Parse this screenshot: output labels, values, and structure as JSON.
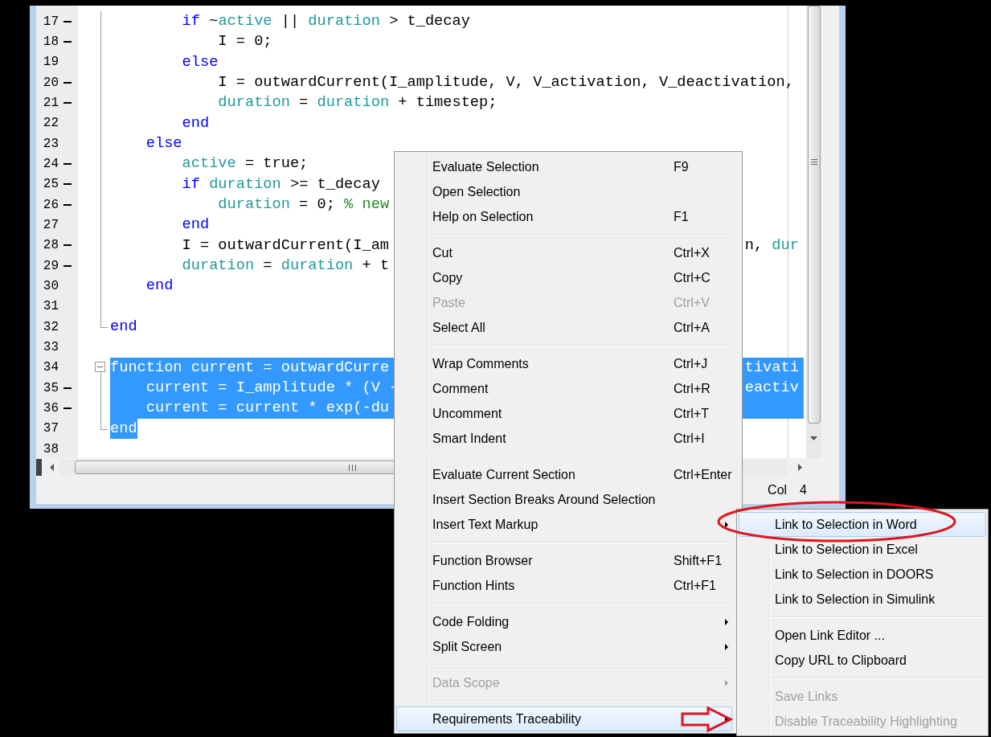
{
  "editor": {
    "lines": [
      {
        "number": "17",
        "marker": true,
        "fold_guide": true,
        "selected": false,
        "segments": [
          {
            "kind": "keyword",
            "text": "        if"
          },
          {
            "kind": "plain",
            "text": " ~"
          },
          {
            "kind": "variable",
            "text": "active"
          },
          {
            "kind": "plain",
            "text": " || "
          },
          {
            "kind": "variable",
            "text": "duration"
          },
          {
            "kind": "plain",
            "text": " > t_decay"
          }
        ]
      },
      {
        "number": "18",
        "marker": true,
        "fold_guide": true,
        "selected": false,
        "segments": [
          {
            "kind": "plain",
            "text": "            I = 0;"
          }
        ]
      },
      {
        "number": "19",
        "marker": false,
        "fold_guide": true,
        "selected": false,
        "segments": [
          {
            "kind": "keyword",
            "text": "        else"
          }
        ]
      },
      {
        "number": "20",
        "marker": true,
        "fold_guide": true,
        "selected": false,
        "segments": [
          {
            "kind": "plain",
            "text": "            I = outwardCurrent(I_amplitude, V, V_activation, V_deactivation,"
          }
        ]
      },
      {
        "number": "21",
        "marker": true,
        "fold_guide": true,
        "selected": false,
        "segments": [
          {
            "kind": "variable",
            "text": "            duration"
          },
          {
            "kind": "plain",
            "text": " = "
          },
          {
            "kind": "variable",
            "text": "duration"
          },
          {
            "kind": "plain",
            "text": " + timestep;"
          }
        ]
      },
      {
        "number": "22",
        "marker": false,
        "fold_guide": true,
        "selected": false,
        "segments": [
          {
            "kind": "keyword",
            "text": "        end"
          }
        ]
      },
      {
        "number": "23",
        "marker": false,
        "fold_guide": true,
        "selected": false,
        "segments": [
          {
            "kind": "keyword",
            "text": "    else"
          }
        ]
      },
      {
        "number": "24",
        "marker": true,
        "fold_guide": true,
        "selected": false,
        "segments": [
          {
            "kind": "variable",
            "text": "        active"
          },
          {
            "kind": "plain",
            "text": " = true;"
          }
        ]
      },
      {
        "number": "25",
        "marker": true,
        "fold_guide": true,
        "selected": false,
        "segments": [
          {
            "kind": "keyword",
            "text": "        if"
          },
          {
            "kind": "variable",
            "text": " duration"
          },
          {
            "kind": "plain",
            "text": " >= t_decay"
          }
        ]
      },
      {
        "number": "26",
        "marker": true,
        "fold_guide": true,
        "selected": false,
        "segments": [
          {
            "kind": "variable",
            "text": "            duration"
          },
          {
            "kind": "plain",
            "text": " = 0; "
          },
          {
            "kind": "comment",
            "text": "% new"
          }
        ]
      },
      {
        "number": "27",
        "marker": false,
        "fold_guide": true,
        "selected": false,
        "segments": [
          {
            "kind": "keyword",
            "text": "        end"
          }
        ]
      },
      {
        "number": "28",
        "marker": true,
        "fold_guide": true,
        "selected": false,
        "segments": [
          {
            "kind": "plain",
            "text": "        I = outwardCurrent(I_am"
          }
        ],
        "tail": [
          {
            "kind": "plain",
            "text": "n, "
          },
          {
            "kind": "variable",
            "text": "dur"
          }
        ]
      },
      {
        "number": "29",
        "marker": true,
        "fold_guide": true,
        "selected": false,
        "segments": [
          {
            "kind": "variable",
            "text": "        duration"
          },
          {
            "kind": "plain",
            "text": " = "
          },
          {
            "kind": "variable",
            "text": "duration"
          },
          {
            "kind": "plain",
            "text": " + t"
          }
        ]
      },
      {
        "number": "30",
        "marker": false,
        "fold_guide": true,
        "selected": false,
        "segments": [
          {
            "kind": "keyword",
            "text": "    end"
          }
        ]
      },
      {
        "number": "31",
        "marker": false,
        "fold_guide": true,
        "selected": false
      },
      {
        "number": "32",
        "marker": false,
        "fold_guide": true,
        "fold_end": true,
        "selected": false,
        "segments": [
          {
            "kind": "keyword",
            "text": "end"
          }
        ]
      },
      {
        "number": "33",
        "marker": false,
        "fold_guide": false,
        "selected": false
      },
      {
        "number": "34",
        "marker": false,
        "fold_guide": false,
        "fold_toggle": true,
        "selected": true,
        "whole_line": true,
        "segments": [
          {
            "kind": "keyword",
            "text": "function"
          },
          {
            "kind": "plain",
            "text": " current = outwardCurre"
          }
        ],
        "tail": [
          {
            "kind": "plain",
            "text": "tivati"
          }
        ]
      },
      {
        "number": "35",
        "marker": true,
        "fold_guide": true,
        "selected": true,
        "whole_line": true,
        "segments": [
          {
            "kind": "plain",
            "text": "    current = I_amplitude * (V -"
          }
        ],
        "tail": [
          {
            "kind": "plain",
            "text": "eactiv"
          }
        ]
      },
      {
        "number": "36",
        "marker": true,
        "fold_guide": true,
        "selected": true,
        "whole_line": true,
        "segments": [
          {
            "kind": "plain",
            "text": "    current = current * exp(-du"
          }
        ]
      },
      {
        "number": "37",
        "marker": false,
        "fold_guide": true,
        "fold_end": true,
        "selected": true,
        "whole_line": false,
        "segments": [
          {
            "kind": "keyword",
            "text": "end"
          }
        ]
      },
      {
        "number": "38",
        "marker": false,
        "fold_guide": false,
        "selected": false
      }
    ],
    "status_bar": {
      "col_label": "Col",
      "col_value": "4"
    }
  },
  "context_menu": {
    "groups": [
      [
        {
          "label": "Evaluate Selection",
          "shortcut": "F9",
          "disabled": false,
          "submenu": false,
          "selected": false
        },
        {
          "label": "Open Selection",
          "disabled": false,
          "submenu": false,
          "selected": false
        },
        {
          "label": "Help on Selection",
          "shortcut": "F1",
          "disabled": false,
          "submenu": false,
          "selected": false
        }
      ],
      [
        {
          "label": "Cut",
          "shortcut": "Ctrl+X",
          "disabled": false,
          "submenu": false,
          "selected": false
        },
        {
          "label": "Copy",
          "shortcut": "Ctrl+C",
          "disabled": false,
          "submenu": false,
          "selected": false
        },
        {
          "label": "Paste",
          "shortcut": "Ctrl+V",
          "disabled": true,
          "submenu": false,
          "selected": false
        },
        {
          "label": "Select All",
          "shortcut": "Ctrl+A",
          "disabled": false,
          "submenu": false,
          "selected": false
        }
      ],
      [
        {
          "label": "Wrap Comments",
          "shortcut": "Ctrl+J",
          "disabled": false,
          "submenu": false,
          "selected": false
        },
        {
          "label": "Comment",
          "shortcut": "Ctrl+R",
          "disabled": false,
          "submenu": false,
          "selected": false
        },
        {
          "label": "Uncomment",
          "shortcut": "Ctrl+T",
          "disabled": false,
          "submenu": false,
          "selected": false
        },
        {
          "label": "Smart Indent",
          "shortcut": "Ctrl+I",
          "disabled": false,
          "submenu": false,
          "selected": false
        }
      ],
      [
        {
          "label": "Evaluate Current Section",
          "shortcut": "Ctrl+Enter",
          "disabled": false,
          "submenu": false,
          "selected": false
        },
        {
          "label": "Insert Section Breaks Around Selection",
          "disabled": false,
          "submenu": false,
          "selected": false
        },
        {
          "label": "Insert Text Markup",
          "disabled": false,
          "submenu": true,
          "selected": false
        }
      ],
      [
        {
          "label": "Function Browser",
          "shortcut": "Shift+F1",
          "disabled": false,
          "submenu": false,
          "selected": false
        },
        {
          "label": "Function Hints",
          "shortcut": "Ctrl+F1",
          "disabled": false,
          "submenu": false,
          "selected": false
        }
      ],
      [
        {
          "label": "Code Folding",
          "disabled": false,
          "submenu": true,
          "selected": false
        },
        {
          "label": "Split Screen",
          "disabled": false,
          "submenu": true,
          "selected": false
        }
      ],
      [
        {
          "label": "Data Scope",
          "disabled": true,
          "submenu": true,
          "selected": false
        }
      ],
      [
        {
          "label": "Requirements Traceability",
          "disabled": false,
          "submenu": true,
          "selected": true
        }
      ]
    ]
  },
  "submenu": {
    "groups": [
      [
        {
          "label": "Link to Selection in Word",
          "disabled": false,
          "submenu": false,
          "selected": true
        },
        {
          "label": "Link to Selection in Excel",
          "disabled": false,
          "submenu": false,
          "selected": false
        },
        {
          "label": "Link to Selection in DOORS",
          "disabled": false,
          "submenu": false,
          "selected": false
        },
        {
          "label": "Link to Selection in Simulink",
          "disabled": false,
          "submenu": false,
          "selected": false
        }
      ],
      [
        {
          "label": "Open Link Editor ...",
          "disabled": false,
          "submenu": false,
          "selected": false
        },
        {
          "label": "Copy URL to Clipboard",
          "disabled": false,
          "submenu": false,
          "selected": false
        }
      ],
      [
        {
          "label": "Save Links",
          "disabled": true,
          "submenu": false,
          "selected": false
        },
        {
          "label": "Disable Traceability Highlighting",
          "disabled": true,
          "submenu": false,
          "selected": false
        }
      ]
    ]
  }
}
